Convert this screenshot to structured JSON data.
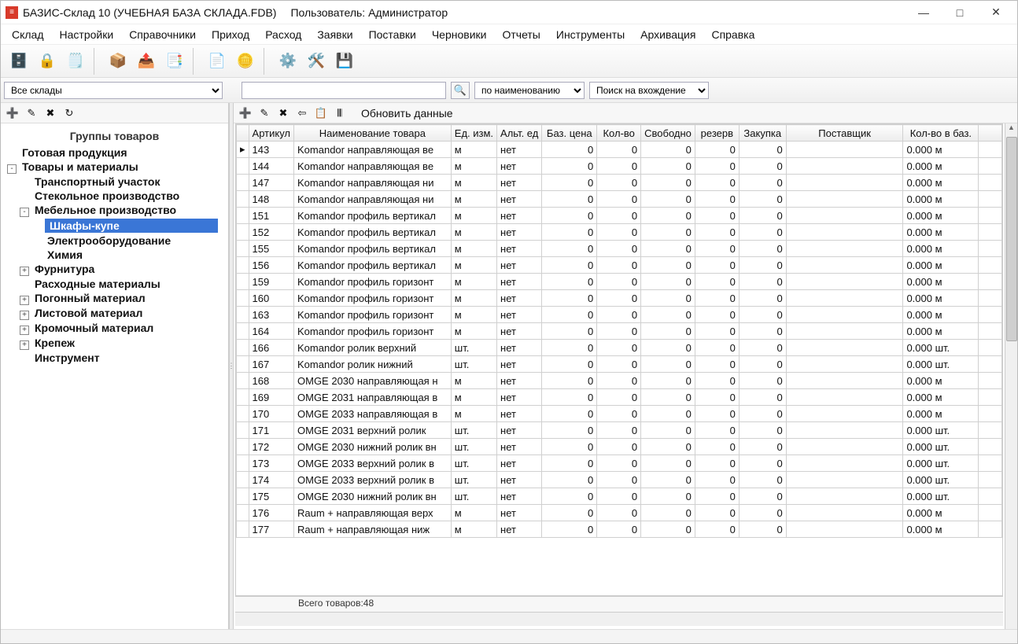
{
  "title": {
    "app": "БАЗИС-Склад 10 (УЧЕБНАЯ БАЗА СКЛАДА.FDB)",
    "user_prefix": "Пользователь:",
    "user": "Администратор"
  },
  "menu": [
    "Склад",
    "Настройки",
    "Справочники",
    "Приход",
    "Расход",
    "Заявки",
    "Поставки",
    "Черновики",
    "Отчеты",
    "Инструменты",
    "Архивация",
    "Справка"
  ],
  "toolbar": [
    {
      "name": "db-icon",
      "glyph": "🗄️"
    },
    {
      "name": "lock-icon",
      "glyph": "🔒"
    },
    {
      "name": "sheet-icon",
      "glyph": "🗒️"
    },
    {
      "sep": true
    },
    {
      "name": "box-in-icon",
      "glyph": "📦"
    },
    {
      "name": "box-out-icon",
      "glyph": "📤"
    },
    {
      "name": "copy-docs-icon",
      "glyph": "📑"
    },
    {
      "sep": true
    },
    {
      "name": "report-icon",
      "glyph": "📄"
    },
    {
      "name": "coins-icon",
      "glyph": "🪙"
    },
    {
      "sep": true
    },
    {
      "name": "db-gear-icon",
      "glyph": "⚙️"
    },
    {
      "name": "table-gear-icon",
      "glyph": "🛠️"
    },
    {
      "name": "db-save-icon",
      "glyph": "💾"
    }
  ],
  "filter": {
    "warehouse_combo": "Все склады",
    "search_value": "",
    "search_mode": "по наименованию",
    "search_scope": "Поиск на вхождение"
  },
  "left": {
    "toolbar_icons": [
      {
        "name": "tree-add-icon",
        "glyph": "➕"
      },
      {
        "name": "tree-edit-icon",
        "glyph": "✎"
      },
      {
        "name": "tree-del-icon",
        "glyph": "✖"
      },
      {
        "name": "tree-refresh-icon",
        "glyph": "↻"
      }
    ],
    "header": "Группы товаров",
    "tree": [
      {
        "label": "Готовая продукция",
        "bold": true,
        "exp": null,
        "level": 0
      },
      {
        "label": "Товары и материалы",
        "bold": true,
        "exp": "-",
        "level": 0
      },
      {
        "label": "Транспортный участок",
        "bold": true,
        "exp": null,
        "level": 1
      },
      {
        "label": "Стекольное производство",
        "bold": true,
        "exp": null,
        "level": 1
      },
      {
        "label": "Мебельное производство",
        "bold": true,
        "exp": "-",
        "level": 1
      },
      {
        "label": "Шкафы-купе",
        "bold": true,
        "exp": null,
        "level": 2,
        "selected": true
      },
      {
        "label": "Электрооборудование",
        "bold": true,
        "exp": null,
        "level": 2
      },
      {
        "label": "Химия",
        "bold": true,
        "exp": null,
        "level": 2
      },
      {
        "label": "Фурнитура",
        "bold": true,
        "exp": "+",
        "level": 1
      },
      {
        "label": "Расходные материалы",
        "bold": true,
        "exp": null,
        "level": 1
      },
      {
        "label": "Погонный материал",
        "bold": true,
        "exp": "+",
        "level": 1
      },
      {
        "label": "Листовой материал",
        "bold": true,
        "exp": "+",
        "level": 1
      },
      {
        "label": "Кромочный материал",
        "bold": true,
        "exp": "+",
        "level": 1
      },
      {
        "label": "Крепеж",
        "bold": true,
        "exp": "+",
        "level": 1
      },
      {
        "label": "Инструмент",
        "bold": true,
        "exp": null,
        "level": 1
      }
    ]
  },
  "right": {
    "toolbar_icons": [
      {
        "name": "row-add-icon",
        "glyph": "➕"
      },
      {
        "name": "row-edit-icon",
        "glyph": "✎"
      },
      {
        "name": "row-del-icon",
        "glyph": "✖"
      },
      {
        "name": "row-back-icon",
        "glyph": "⇦"
      },
      {
        "name": "row-copy-icon",
        "glyph": "📋"
      },
      {
        "name": "barcode-icon",
        "glyph": "𝄃𝄃"
      }
    ],
    "refresh_label": "Обновить данные",
    "columns": [
      {
        "key": "mark",
        "label": ""
      },
      {
        "key": "art",
        "label": "Артикул"
      },
      {
        "key": "name",
        "label": "Наименование товара"
      },
      {
        "key": "unit",
        "label": "Ед. изм."
      },
      {
        "key": "alt",
        "label": "Альт. ед"
      },
      {
        "key": "price",
        "label": "Баз. цена"
      },
      {
        "key": "qty",
        "label": "Кол-во"
      },
      {
        "key": "free",
        "label": "Свободно"
      },
      {
        "key": "res",
        "label": "резерв"
      },
      {
        "key": "buy",
        "label": "Закупка"
      },
      {
        "key": "sup",
        "label": "Поставщик"
      },
      {
        "key": "baseq",
        "label": "Кол-во в баз."
      },
      {
        "key": "blank",
        "label": ""
      }
    ],
    "rows": [
      {
        "mark": "▸",
        "art": "143",
        "name": "Komandor направляющая ве",
        "unit": "м",
        "alt": "нет",
        "price": "0",
        "qty": "0",
        "free": "0",
        "res": "0",
        "buy": "0",
        "sup": "",
        "baseq": "0.000 м"
      },
      {
        "mark": "",
        "art": "144",
        "name": "Komandor направляющая ве",
        "unit": "м",
        "alt": "нет",
        "price": "0",
        "qty": "0",
        "free": "0",
        "res": "0",
        "buy": "0",
        "sup": "",
        "baseq": "0.000 м"
      },
      {
        "mark": "",
        "art": "147",
        "name": "Komandor направляющая ни",
        "unit": "м",
        "alt": "нет",
        "price": "0",
        "qty": "0",
        "free": "0",
        "res": "0",
        "buy": "0",
        "sup": "",
        "baseq": "0.000 м"
      },
      {
        "mark": "",
        "art": "148",
        "name": "Komandor направляющая ни",
        "unit": "м",
        "alt": "нет",
        "price": "0",
        "qty": "0",
        "free": "0",
        "res": "0",
        "buy": "0",
        "sup": "",
        "baseq": "0.000 м"
      },
      {
        "mark": "",
        "art": "151",
        "name": "Komandor профиль вертикал",
        "unit": "м",
        "alt": "нет",
        "price": "0",
        "qty": "0",
        "free": "0",
        "res": "0",
        "buy": "0",
        "sup": "",
        "baseq": "0.000 м"
      },
      {
        "mark": "",
        "art": "152",
        "name": "Komandor профиль вертикал",
        "unit": "м",
        "alt": "нет",
        "price": "0",
        "qty": "0",
        "free": "0",
        "res": "0",
        "buy": "0",
        "sup": "",
        "baseq": "0.000 м"
      },
      {
        "mark": "",
        "art": "155",
        "name": "Komandor профиль вертикал",
        "unit": "м",
        "alt": "нет",
        "price": "0",
        "qty": "0",
        "free": "0",
        "res": "0",
        "buy": "0",
        "sup": "",
        "baseq": "0.000 м"
      },
      {
        "mark": "",
        "art": "156",
        "name": "Komandor профиль вертикал",
        "unit": "м",
        "alt": "нет",
        "price": "0",
        "qty": "0",
        "free": "0",
        "res": "0",
        "buy": "0",
        "sup": "",
        "baseq": "0.000 м"
      },
      {
        "mark": "",
        "art": "159",
        "name": "Komandor профиль горизонт",
        "unit": "м",
        "alt": "нет",
        "price": "0",
        "qty": "0",
        "free": "0",
        "res": "0",
        "buy": "0",
        "sup": "",
        "baseq": "0.000 м"
      },
      {
        "mark": "",
        "art": "160",
        "name": "Komandor профиль горизонт",
        "unit": "м",
        "alt": "нет",
        "price": "0",
        "qty": "0",
        "free": "0",
        "res": "0",
        "buy": "0",
        "sup": "",
        "baseq": "0.000 м"
      },
      {
        "mark": "",
        "art": "163",
        "name": "Komandor профиль горизонт",
        "unit": "м",
        "alt": "нет",
        "price": "0",
        "qty": "0",
        "free": "0",
        "res": "0",
        "buy": "0",
        "sup": "",
        "baseq": "0.000 м"
      },
      {
        "mark": "",
        "art": "164",
        "name": "Komandor профиль горизонт",
        "unit": "м",
        "alt": "нет",
        "price": "0",
        "qty": "0",
        "free": "0",
        "res": "0",
        "buy": "0",
        "sup": "",
        "baseq": "0.000 м"
      },
      {
        "mark": "",
        "art": "166",
        "name": "Komandor ролик верхний",
        "unit": "шт.",
        "alt": "нет",
        "price": "0",
        "qty": "0",
        "free": "0",
        "res": "0",
        "buy": "0",
        "sup": "",
        "baseq": "0.000 шт."
      },
      {
        "mark": "",
        "art": "167",
        "name": "Komandor ролик нижний",
        "unit": "шт.",
        "alt": "нет",
        "price": "0",
        "qty": "0",
        "free": "0",
        "res": "0",
        "buy": "0",
        "sup": "",
        "baseq": "0.000 шт."
      },
      {
        "mark": "",
        "art": "168",
        "name": "OMGE 2030 направляющая н",
        "unit": "м",
        "alt": "нет",
        "price": "0",
        "qty": "0",
        "free": "0",
        "res": "0",
        "buy": "0",
        "sup": "",
        "baseq": "0.000 м"
      },
      {
        "mark": "",
        "art": "169",
        "name": "OMGE 2031 направляющая в",
        "unit": "м",
        "alt": "нет",
        "price": "0",
        "qty": "0",
        "free": "0",
        "res": "0",
        "buy": "0",
        "sup": "",
        "baseq": "0.000 м"
      },
      {
        "mark": "",
        "art": "170",
        "name": "OMGE 2033 направляющая в",
        "unit": "м",
        "alt": "нет",
        "price": "0",
        "qty": "0",
        "free": "0",
        "res": "0",
        "buy": "0",
        "sup": "",
        "baseq": "0.000 м"
      },
      {
        "mark": "",
        "art": "171",
        "name": "OMGE 2031 верхний ролик",
        "unit": "шт.",
        "alt": "нет",
        "price": "0",
        "qty": "0",
        "free": "0",
        "res": "0",
        "buy": "0",
        "sup": "",
        "baseq": "0.000 шт."
      },
      {
        "mark": "",
        "art": "172",
        "name": "OMGE 2030 нижний ролик вн",
        "unit": "шт.",
        "alt": "нет",
        "price": "0",
        "qty": "0",
        "free": "0",
        "res": "0",
        "buy": "0",
        "sup": "",
        "baseq": "0.000 шт."
      },
      {
        "mark": "",
        "art": "173",
        "name": "OMGE 2033 верхний ролик в",
        "unit": "шт.",
        "alt": "нет",
        "price": "0",
        "qty": "0",
        "free": "0",
        "res": "0",
        "buy": "0",
        "sup": "",
        "baseq": "0.000 шт."
      },
      {
        "mark": "",
        "art": "174",
        "name": "OMGE 2033 верхний ролик в",
        "unit": "шт.",
        "alt": "нет",
        "price": "0",
        "qty": "0",
        "free": "0",
        "res": "0",
        "buy": "0",
        "sup": "",
        "baseq": "0.000 шт."
      },
      {
        "mark": "",
        "art": "175",
        "name": "OMGE 2030 нижний ролик вн",
        "unit": "шт.",
        "alt": "нет",
        "price": "0",
        "qty": "0",
        "free": "0",
        "res": "0",
        "buy": "0",
        "sup": "",
        "baseq": "0.000 шт."
      },
      {
        "mark": "",
        "art": "176",
        "name": "Raum + направляющая верх",
        "unit": "м",
        "alt": "нет",
        "price": "0",
        "qty": "0",
        "free": "0",
        "res": "0",
        "buy": "0",
        "sup": "",
        "baseq": "0.000 м"
      },
      {
        "mark": "",
        "art": "177",
        "name": "Raum + направляющая ниж",
        "unit": "м",
        "alt": "нет",
        "price": "0",
        "qty": "0",
        "free": "0",
        "res": "0",
        "buy": "0",
        "sup": "",
        "baseq": "0.000 м"
      }
    ],
    "footer": "Всего товаров:48"
  }
}
